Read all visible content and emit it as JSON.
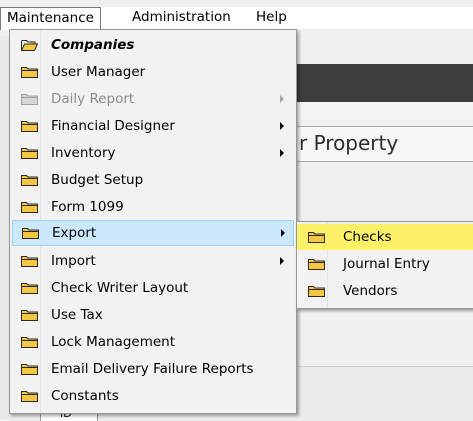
{
  "menubar": {
    "items": [
      "Maintenance",
      "Administration",
      "Help"
    ]
  },
  "background": {
    "panel_title": "r Property",
    "lower_tab": "ID"
  },
  "main_menu": {
    "items": [
      {
        "label": "Companies",
        "icon": "folder-open-icon",
        "style": "bold-italic",
        "submenu": false
      },
      {
        "label": "User Manager",
        "icon": "folder-icon",
        "submenu": false
      },
      {
        "label": "Daily Report",
        "icon": "folder-icon",
        "disabled": true,
        "submenu": true
      },
      {
        "label": "Financial Designer",
        "icon": "folder-icon",
        "submenu": true
      },
      {
        "label": "Inventory",
        "icon": "folder-icon",
        "submenu": true
      },
      {
        "label": "Budget Setup",
        "icon": "folder-icon",
        "submenu": false
      },
      {
        "label": "Form 1099",
        "icon": "folder-icon",
        "submenu": false
      },
      {
        "label": "Export",
        "icon": "folder-icon",
        "submenu": true,
        "highlighted": true
      },
      {
        "label": "Import",
        "icon": "folder-icon",
        "submenu": true
      },
      {
        "label": "Check Writer Layout",
        "icon": "folder-icon",
        "submenu": false
      },
      {
        "label": "Use Tax",
        "icon": "folder-icon",
        "submenu": false
      },
      {
        "label": "Lock Management",
        "icon": "folder-icon",
        "submenu": false
      },
      {
        "label": "Email Delivery Failure Reports",
        "icon": "folder-icon",
        "submenu": false
      },
      {
        "label": "Constants",
        "icon": "folder-icon",
        "submenu": false
      }
    ]
  },
  "export_submenu": {
    "items": [
      {
        "label": "Checks",
        "icon": "folder-icon",
        "highlighted": true
      },
      {
        "label": "Journal Entry",
        "icon": "folder-icon"
      },
      {
        "label": "Vendors",
        "icon": "folder-icon"
      }
    ]
  },
  "colors": {
    "hover": "#cce8ff",
    "hover_border": "#99d1ff",
    "submenu_highlight": "#fdf16a",
    "folder_yellow": "#f3c744"
  }
}
